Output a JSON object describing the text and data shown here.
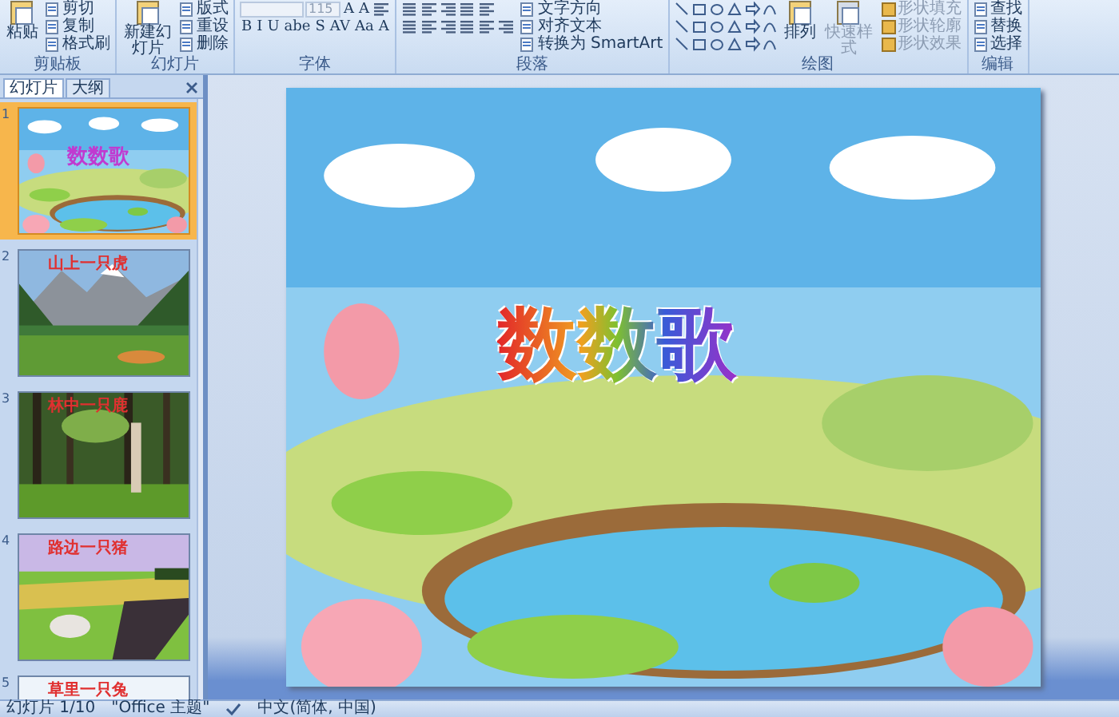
{
  "ribbon": {
    "groups": [
      {
        "label": "剪贴板",
        "columns": [
          [
            [
              {
                "kind": "large",
                "label": "粘贴"
              }
            ]
          ],
          [
            [
              {
                "kind": "small",
                "label": "剪切"
              }
            ],
            [
              {
                "kind": "small",
                "label": "复制"
              }
            ],
            [
              {
                "kind": "small",
                "label": "格式刷"
              }
            ]
          ]
        ]
      },
      {
        "label": "幻灯片",
        "columns": [
          [
            [
              {
                "kind": "large",
                "label": "新建幻灯片"
              }
            ]
          ],
          [
            [
              {
                "kind": "small",
                "label": "版式"
              }
            ],
            [
              {
                "kind": "small",
                "label": "重设"
              }
            ],
            [
              {
                "kind": "small",
                "label": "删除"
              }
            ]
          ]
        ]
      },
      {
        "label": "字体",
        "columns": [
          [
            [
              {
                "kind": "field",
                "disabled": true
              },
              {
                "kind": "field",
                "value": "115",
                "disabled": true
              },
              {
                "kind": "glyph",
                "label": "A"
              },
              {
                "kind": "glyph",
                "label": "A"
              },
              {
                "kind": "icon"
              }
            ],
            [
              {
                "kind": "glyph",
                "label": "B"
              },
              {
                "kind": "glyph",
                "label": "I"
              },
              {
                "kind": "glyph",
                "label": "U"
              },
              {
                "kind": "glyph",
                "label": "abe"
              },
              {
                "kind": "glyph",
                "label": "S"
              },
              {
                "kind": "glyph",
                "label": "AV"
              },
              {
                "kind": "glyph",
                "label": "Aa"
              },
              {
                "kind": "glyph",
                "label": "A"
              }
            ]
          ]
        ]
      },
      {
        "label": "段落",
        "columns": [
          [
            [
              {
                "kind": "icon"
              },
              {
                "kind": "icon"
              },
              {
                "kind": "icon"
              },
              {
                "kind": "icon"
              },
              {
                "kind": "icon"
              }
            ],
            [
              {
                "kind": "icon"
              },
              {
                "kind": "icon"
              },
              {
                "kind": "icon"
              },
              {
                "kind": "icon"
              },
              {
                "kind": "icon"
              },
              {
                "kind": "icon"
              }
            ]
          ],
          [
            [
              {
                "kind": "small",
                "label": "文字方向"
              }
            ],
            [
              {
                "kind": "small",
                "label": "对齐文本"
              }
            ],
            [
              {
                "kind": "small",
                "label": "转换为 SmartArt"
              }
            ]
          ]
        ]
      },
      {
        "label": "绘图",
        "columns": [
          [
            [
              {
                "kind": "shape"
              },
              {
                "kind": "shape"
              },
              {
                "kind": "shape"
              },
              {
                "kind": "shape"
              },
              {
                "kind": "shape"
              },
              {
                "kind": "shape"
              }
            ],
            [
              {
                "kind": "shape"
              },
              {
                "kind": "shape"
              },
              {
                "kind": "shape"
              },
              {
                "kind": "shape"
              },
              {
                "kind": "shape"
              },
              {
                "kind": "shape"
              }
            ],
            [
              {
                "kind": "shape"
              },
              {
                "kind": "shape"
              },
              {
                "kind": "shape"
              },
              {
                "kind": "shape"
              },
              {
                "kind": "shape"
              },
              {
                "kind": "shape"
              }
            ]
          ],
          [
            [
              {
                "kind": "large",
                "label": "排列"
              }
            ]
          ],
          [
            [
              {
                "kind": "large",
                "label": "快速样式",
                "disabled": true
              }
            ]
          ],
          [
            [
              {
                "kind": "small",
                "label": "形状填充",
                "disabled": true
              }
            ],
            [
              {
                "kind": "small",
                "label": "形状轮廓",
                "disabled": true
              }
            ],
            [
              {
                "kind": "small",
                "label": "形状效果",
                "disabled": true
              }
            ]
          ]
        ]
      },
      {
        "label": "编辑",
        "columns": [
          [
            [
              {
                "kind": "small",
                "label": "查找"
              }
            ],
            [
              {
                "kind": "small",
                "label": "替换"
              }
            ],
            [
              {
                "kind": "small",
                "label": "选择"
              }
            ]
          ]
        ]
      }
    ]
  },
  "panel": {
    "tabs": [
      {
        "label": "幻灯片",
        "selected": true
      },
      {
        "label": "大纲",
        "selected": false
      }
    ],
    "slides": [
      {
        "number": "1",
        "title": "数数歌",
        "selected": true
      },
      {
        "number": "2",
        "title": "山上一只虎",
        "selected": false
      },
      {
        "number": "3",
        "title": "林中一只鹿",
        "selected": false
      },
      {
        "number": "4",
        "title": "路边一只猪",
        "selected": false
      },
      {
        "number": "5",
        "title": "草里一只兔",
        "selected": false
      }
    ]
  },
  "slide": {
    "title": "数数歌"
  },
  "status_bar": {
    "slide": "幻灯片 1/10",
    "theme": "\"Office 主题\"",
    "language": "中文(简体, 中国)"
  }
}
